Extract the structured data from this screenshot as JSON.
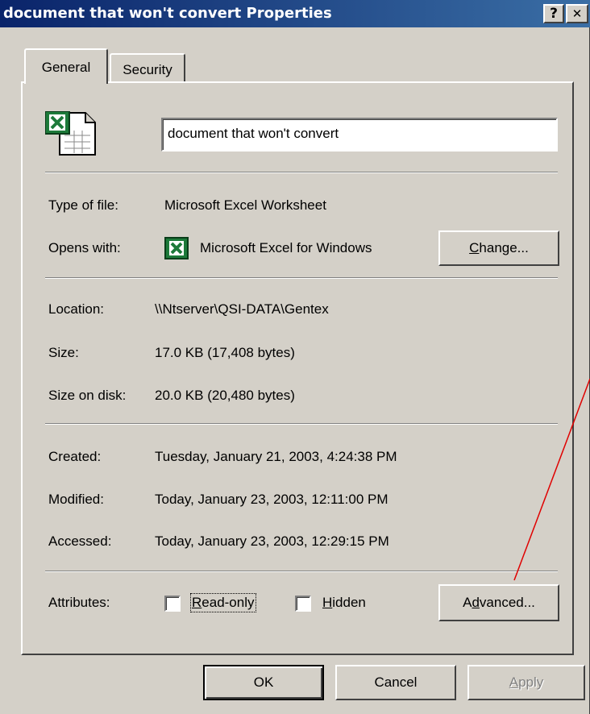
{
  "window": {
    "title": "document that won't convert Properties",
    "help_glyph": "?",
    "close_glyph": "✕"
  },
  "tabs": [
    {
      "label": "General",
      "active": true
    },
    {
      "label": "Security",
      "active": false
    }
  ],
  "file": {
    "name_value": "document that won't convert",
    "icon": "excel-file-icon"
  },
  "type": {
    "label": "Type of file:",
    "value": "Microsoft Excel Worksheet"
  },
  "opens": {
    "label": "Opens with:",
    "value": "Microsoft Excel for Windows",
    "icon": "excel-app-icon",
    "change_label_pre": "",
    "change_label_accel": "C",
    "change_label_post": "hange..."
  },
  "location": {
    "label": "Location:",
    "value": "\\\\Ntserver\\QSI-DATA\\Gentex"
  },
  "size": {
    "label": "Size:",
    "value": "17.0 KB (17,408 bytes)"
  },
  "size_on_disk": {
    "label": "Size on disk:",
    "value": "20.0 KB (20,480 bytes)"
  },
  "created": {
    "label": "Created:",
    "value": "Tuesday, January 21, 2003, 4:24:38 PM"
  },
  "modified": {
    "label": "Modified:",
    "value": "Today, January 23, 2003, 12:11:00 PM"
  },
  "accessed": {
    "label": "Accessed:",
    "value": "Today, January 23, 2003, 12:29:15 PM"
  },
  "attributes": {
    "label": "Attributes:",
    "readonly_accel": "R",
    "readonly_rest": "ead-only",
    "readonly_checked": false,
    "hidden_accel": "H",
    "hidden_rest": "idden",
    "hidden_checked": false,
    "advanced_pre": "A",
    "advanced_accel": "d",
    "advanced_post": "vanced..."
  },
  "buttons": {
    "ok": "OK",
    "cancel": "Cancel",
    "apply_accel": "A",
    "apply_rest": "pply"
  },
  "colors": {
    "annotation_line": "#e00000",
    "excel_green": "#1d7a3a"
  }
}
